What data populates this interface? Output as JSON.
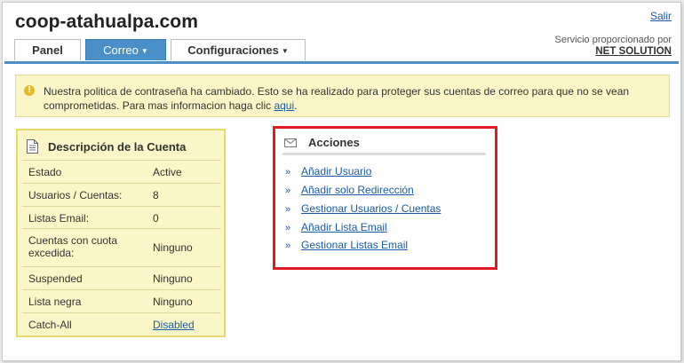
{
  "header": {
    "site_title": "coop-atahualpa.com",
    "logout_label": "Salir",
    "provider_label": "Servicio proporcionado por",
    "provider_name": "NET SOLUTION"
  },
  "tabs": [
    {
      "label": "Panel",
      "active": false,
      "caret": ""
    },
    {
      "label": "Correo",
      "active": true,
      "caret": "▼"
    },
    {
      "label": "Configuraciones",
      "active": false,
      "caret": "▼"
    }
  ],
  "notice": {
    "icon": "info-icon",
    "text": "Nuestra politica de contraseña ha cambiado. Esto se ha realizado para proteger sus cuentas de correo para que no se vean comprometidas. Para mas informacion haga clic",
    "link_label": "aqui",
    "suffix": "."
  },
  "account": {
    "title": "Descripción de la Cuenta",
    "icon": "document-icon",
    "rows": [
      {
        "label": "Estado",
        "value": "Active",
        "link": false
      },
      {
        "label": "Usuarios / Cuentas:",
        "value": "8",
        "link": false
      },
      {
        "label": "Listas Email:",
        "value": "0",
        "link": false
      },
      {
        "label": "Cuentas con cuota excedida:",
        "value": "Ninguno",
        "link": false
      },
      {
        "label": "Suspended",
        "value": "Ninguno",
        "link": false
      },
      {
        "label": "Lista negra",
        "value": "Ninguno",
        "link": false
      },
      {
        "label": "Catch-All",
        "value": "Disabled",
        "link": true
      }
    ]
  },
  "actions": {
    "title": "Acciones",
    "icon": "envelope-icon",
    "bullet": "»",
    "items": [
      "Añadir Usuario",
      "Añadir solo Redirección",
      "Gestionar Usuarios / Cuentas",
      "Añadir Lista Email",
      "Gestionar Listas Email"
    ]
  },
  "colors": {
    "accent": "#4a90c8",
    "link": "#1a5aa6",
    "notice_bg": "#fbf6c7",
    "highlight_border": "#e01a22"
  }
}
